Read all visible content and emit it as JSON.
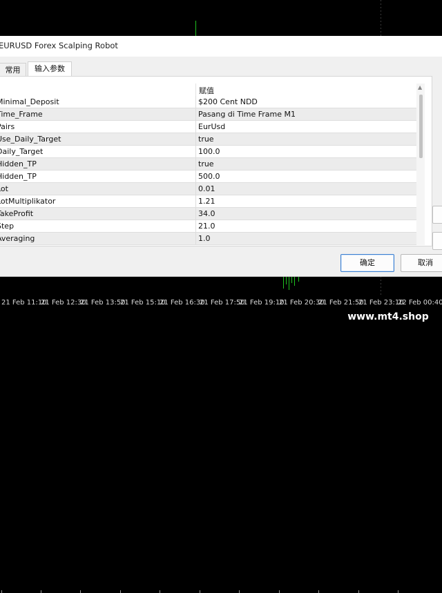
{
  "dialog": {
    "title": "EURUSD Forex Scalping Robot",
    "tabs": [
      {
        "label": "常用",
        "selected": false
      },
      {
        "label": "输入参数",
        "selected": true
      }
    ],
    "grid": {
      "header_value": "赋值",
      "rows": [
        {
          "name": "Minimal_Deposit",
          "value": "$200 Cent NDD"
        },
        {
          "name": "Time_Frame",
          "value": "Pasang di Time Frame M1"
        },
        {
          "name": "Pairs",
          "value": "EurUsd"
        },
        {
          "name": "Use_Daily_Target",
          "value": "true"
        },
        {
          "name": "Daily_Target",
          "value": "100.0"
        },
        {
          "name": "Hidden_TP",
          "value": "true"
        },
        {
          "name": "Hidden_TP",
          "value": "500.0"
        },
        {
          "name": "Lot",
          "value": "0.01"
        },
        {
          "name": "LotMultiplikator",
          "value": "1.21"
        },
        {
          "name": "TakeProfit",
          "value": "34.0"
        },
        {
          "name": "Step",
          "value": "21.0"
        },
        {
          "name": "Averaging",
          "value": "1.0"
        }
      ]
    },
    "buttons": {
      "ok": "确定",
      "cancel": "取消"
    }
  },
  "chart": {
    "time_labels": [
      "21 Feb 11:10",
      "21 Feb 12:30",
      "21 Feb 13:50",
      "21 Feb 15:10",
      "21 Feb 16:30",
      "21 Feb 17:50",
      "21 Feb 19:10",
      "21 Feb 20:30",
      "21 Feb 21:50",
      "21 Feb 23:10",
      "22 Feb 00:40"
    ]
  },
  "watermark": "www.mt4.shop",
  "colors": {
    "chart_background": "#000000",
    "candle_bull": "#1fc21f",
    "ok_button_border": "#3c7fd0"
  }
}
